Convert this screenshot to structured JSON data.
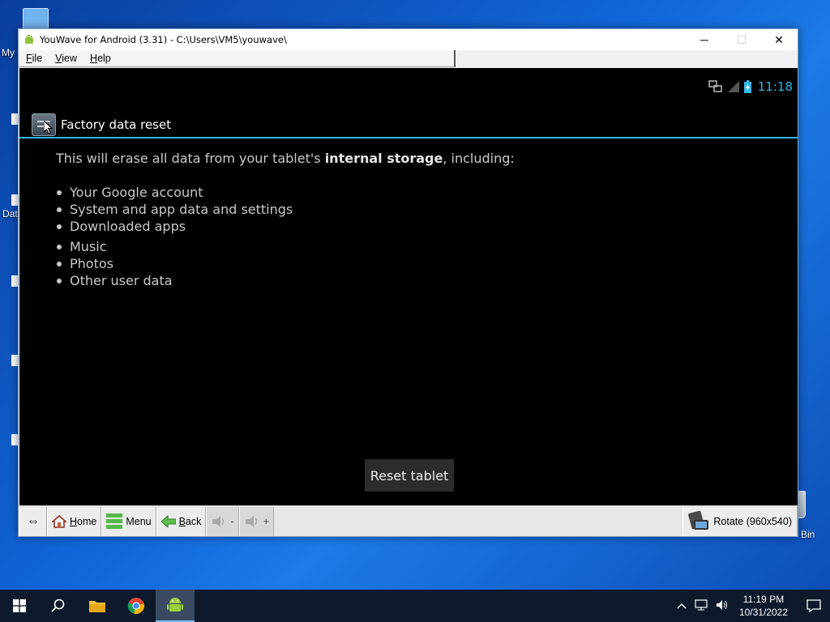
{
  "desktop": {
    "icon_labels": [
      "My",
      "Dat",
      "Bin"
    ]
  },
  "window": {
    "title": "YouWave for Android (3.31) - C:\\Users\\VM5\\youwave\\",
    "minimize_glyph": "─",
    "maximize_glyph": "☐",
    "close_glyph": "✕"
  },
  "menubar": {
    "items": [
      {
        "label": "File",
        "mnemonic": "F",
        "rest": "ile"
      },
      {
        "label": "View",
        "mnemonic": "V",
        "rest": "iew"
      },
      {
        "label": "Help",
        "mnemonic": "H",
        "rest": "elp"
      }
    ]
  },
  "android": {
    "status_time": "11:18",
    "accent_color": "#33b5e5",
    "actionbar_title": "Factory data reset",
    "intro_prefix": "This will erase all data from your tablet's ",
    "intro_bold": "internal storage",
    "intro_suffix": ", including:",
    "bullets": [
      "Your Google account",
      "System and app data and settings",
      "Downloaded apps",
      "Music",
      "Photos",
      "Other user data"
    ],
    "reset_button": "Reset tablet"
  },
  "toolbar": {
    "resize_glyph": "⇔",
    "home": {
      "mnemonic": "H",
      "rest": "ome"
    },
    "menu": "Menu",
    "back": {
      "mnemonic": "B",
      "rest": "ack"
    },
    "vol_down": "-",
    "vol_up": "+",
    "rotate": "Rotate (960x540)"
  },
  "taskbar": {
    "time": "11:19 PM",
    "date": "10/31/2022"
  }
}
